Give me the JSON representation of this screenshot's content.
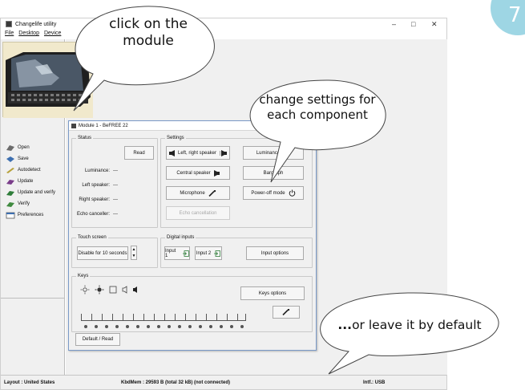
{
  "window": {
    "title": "Changelife utility",
    "menus": [
      "File",
      "Desktop",
      "Device"
    ],
    "controls": {
      "minimize": "–",
      "maximize": "□",
      "close": "✕"
    }
  },
  "badge": {
    "text": "7",
    "color": "#9ed6e4"
  },
  "sidebar": {
    "items": [
      {
        "label": "Open",
        "icon": "open-icon"
      },
      {
        "label": "Save",
        "icon": "save-icon"
      },
      {
        "label": "Autodetect",
        "icon": "autodetect-icon"
      },
      {
        "label": "Update",
        "icon": "update-icon"
      },
      {
        "label": "Update and verify",
        "icon": "update-verify-icon"
      },
      {
        "label": "Verify",
        "icon": "verify-icon"
      },
      {
        "label": "Preferences",
        "icon": "preferences-icon"
      }
    ]
  },
  "module": {
    "title": "Module 1 - BeFREE 22",
    "status": {
      "label": "Status",
      "read_button": "Read",
      "rows": [
        {
          "label": "Luminance:",
          "value": "---"
        },
        {
          "label": "Left speaker:",
          "value": "---"
        },
        {
          "label": "Right speaker:",
          "value": "---"
        },
        {
          "label": "Echo canceller:",
          "value": "---"
        }
      ]
    },
    "settings": {
      "label": "Settings",
      "buttons": {
        "left_right_speaker": "Left, right speaker",
        "luminance": "Luminance",
        "central_speaker": "Central speaker",
        "bargraph": "Bargraph",
        "microphone": "Microphone",
        "power_off_mode": "Power-off mode",
        "echo_cancellation": "Echo cancellation"
      }
    },
    "touch_screen": {
      "label": "Touch screen",
      "value": "Disable for 10 seconds"
    },
    "digital_inputs": {
      "label": "Digital inputs",
      "input1": "Input 1",
      "input2": "Input 2",
      "options": "Input options"
    },
    "keys": {
      "label": "Keys",
      "options": "Keys options"
    },
    "default_read": "Default / Read"
  },
  "statusbar": {
    "layout": "Layout : United States",
    "memory": "KbdMem : 29593 B   (total 32 kB) (not connected)",
    "interface": "Intf.: USB"
  },
  "callouts": {
    "module": "click on the\nmodule",
    "settings": "change settings for\neach component",
    "default_prefix": "...",
    "default": "or leave it by default"
  }
}
